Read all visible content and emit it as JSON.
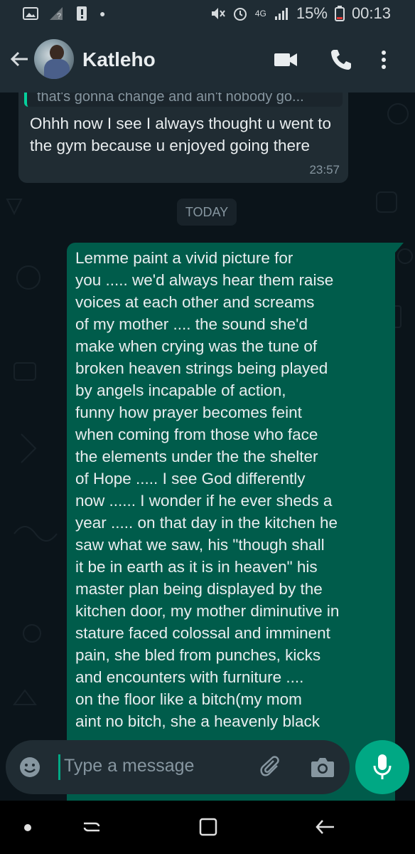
{
  "status_bar": {
    "battery": "15%",
    "time": "00:13",
    "network": "4G"
  },
  "header": {
    "contact_name": "Katleho",
    "icons": [
      "back-arrow-icon",
      "video-call-icon",
      "phone-icon",
      "more-options-icon"
    ]
  },
  "messages": {
    "incoming": {
      "quoted_text": "that's gonna change and ain't nobody go...",
      "text": "Ohhh now I see I always thought u went to the gym because u enjoyed going there",
      "time": "23:57"
    },
    "date_separator": "TODAY",
    "outgoing": {
      "text": "Lemme paint a vivid picture for\nyou ..... we'd always hear them raise\nvoices at each other and screams\nof my mother .... the sound she'd\nmake when crying was the tune of\nbroken heaven strings being played\nby angels incapable of action,\nfunny how prayer becomes feint\nwhen coming from those who face\nthe elements under the the shelter\nof Hope ..... I see God differently\nnow ...... I wonder if he ever sheds a\nyear ..... on that day in the kitchen he\nsaw what we saw, his \"though shall\nit be in earth as it is in heaven\" his\nmaster plan being displayed by the\nkitchen door, my mother diminutive in\nstature faced colossal and imminent\npain, she bled from punches, kicks\nand encounters with furniture ....\non the floor like a bitch(my mom\naint no bitch, she a heavenly black"
    }
  },
  "input": {
    "placeholder": "Type a message"
  },
  "colors": {
    "outgoing_bubble": "#005c4b",
    "incoming_bubble": "#202c33",
    "accent": "#00a884"
  }
}
